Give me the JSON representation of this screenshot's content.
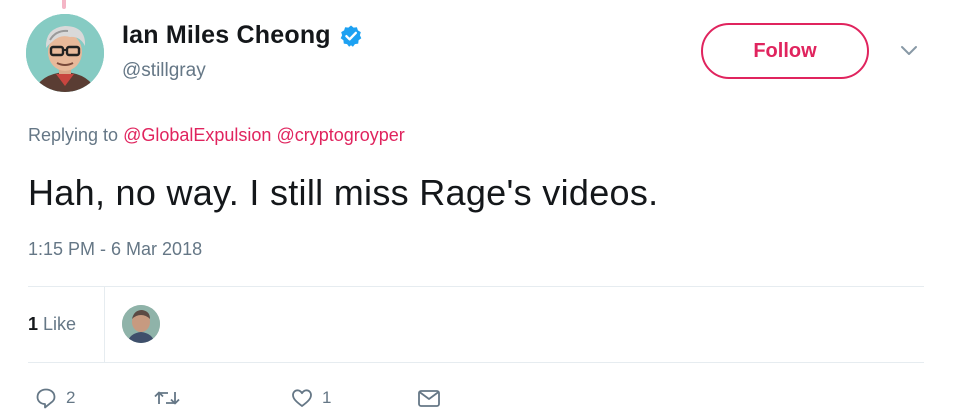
{
  "author": {
    "display_name": "Ian Miles Cheong",
    "handle": "@stillgray",
    "verified": true
  },
  "follow_button": {
    "label": "Follow"
  },
  "reply_context": {
    "prefix": "Replying to",
    "mentions": [
      "@GlobalExpulsion",
      "@cryptogroyper"
    ]
  },
  "tweet": {
    "text": "Hah, no way. I still miss Rage's videos.",
    "timestamp": "1:15 PM - 6 Mar 2018"
  },
  "stats": {
    "likes_count": "1",
    "likes_label": "Like"
  },
  "actions": {
    "reply_count": "2",
    "retweet_count": "",
    "like_count": "1"
  },
  "icons": {
    "verified": "verified-badge-icon",
    "caret": "chevron-down-icon",
    "reply": "reply-icon",
    "retweet": "retweet-icon",
    "like": "heart-icon",
    "dm": "envelope-icon"
  },
  "colors": {
    "accent": "#e0245e",
    "verified": "#1da1f2",
    "secondary_text": "#657786",
    "primary_text": "#14171a",
    "divider": "#e6ecf0"
  }
}
